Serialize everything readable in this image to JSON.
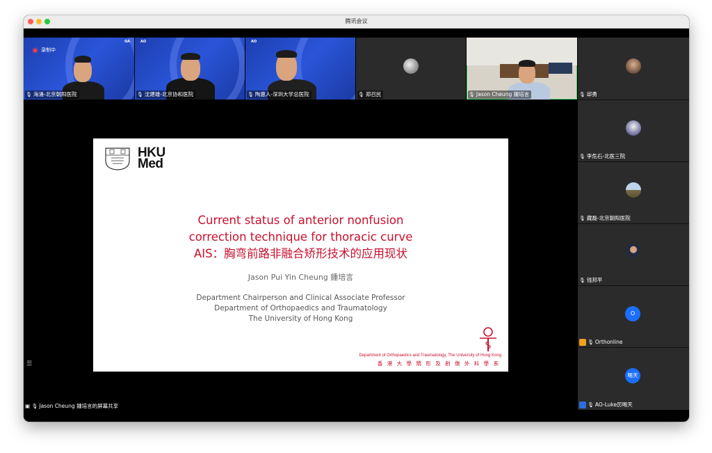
{
  "window": {
    "title": "腾讯会议"
  },
  "recording": {
    "label": "录制中"
  },
  "top_tiles": [
    {
      "name": "海涌-北京朝阳医院"
    },
    {
      "name": "沈建雄-北京协和医院"
    },
    {
      "name": "陶惠人-深圳大学总医院"
    },
    {
      "name": "郑召民"
    },
    {
      "name": "Jason Cheung 鍾培言"
    }
  ],
  "side_tiles": [
    {
      "name": "邱勇"
    },
    {
      "name": "李危石-北医三院"
    },
    {
      "name": "藏磊-北京朝阳医院"
    },
    {
      "name": "钱邦平"
    },
    {
      "name": "Orthonline",
      "initial": "O"
    },
    {
      "name": "AO-Luke厉晹天",
      "initial": "晹天"
    }
  ],
  "slide": {
    "logo_text_1": "HKU",
    "logo_text_2": "Med",
    "title_line1": "Current status of anterior nonfusion",
    "title_line2": "correction technique for thoracic curve",
    "title_line3": "AIS：胸弯前路非融合矫形技术的应用现状",
    "author": "Jason Pui Yin Cheung 鍾培言",
    "aff1": "Department Chairperson and Clinical Associate Professor",
    "aff2": "Department of Orthopaedics and Traumatology",
    "aff3": "The University of Hong Kong",
    "dept_en": "Department of Orthopaedics and Traumatology, The University of Hong Kong",
    "dept_zh": "香 港 大 學 矯 形 及 創 傷 外 科 學 系"
  },
  "share": {
    "label": "Jason Cheung 鍾培言的屏幕共享"
  },
  "colors": {
    "accent_green": "#3fd26b",
    "slide_red": "#c8102e",
    "tile_blue": "#2a55d8"
  },
  "icons": [
    "mic-icon",
    "screen-share-icon",
    "list-icon",
    "record-dot-icon"
  ]
}
